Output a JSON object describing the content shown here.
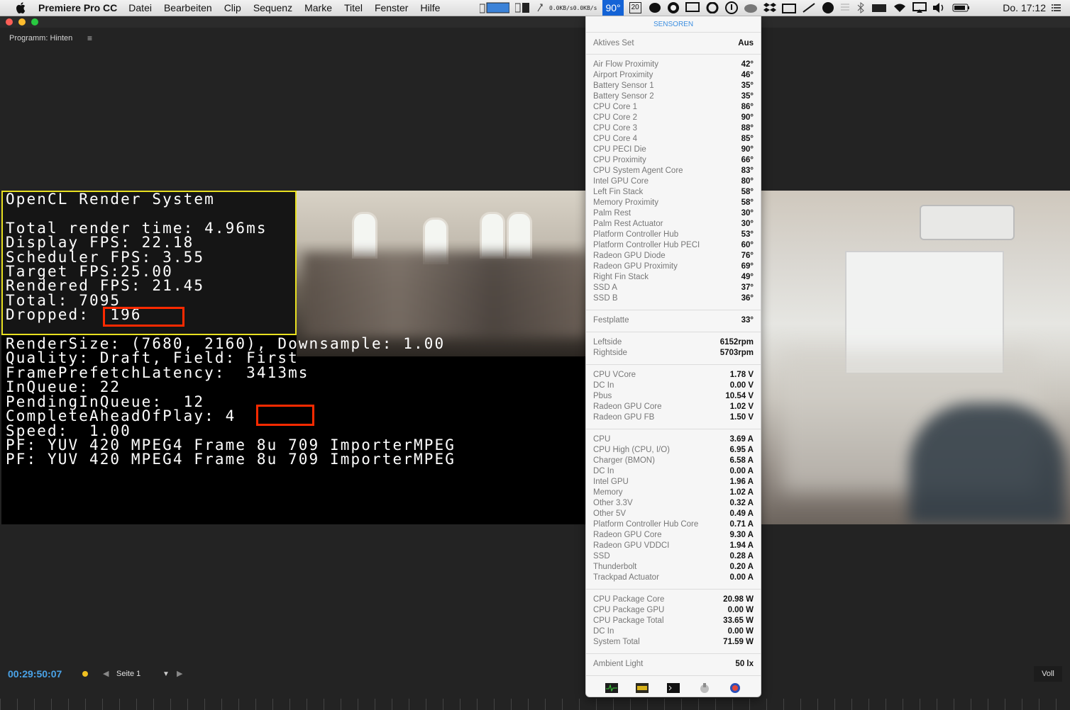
{
  "menubar": {
    "app_name": "Premiere Pro CC",
    "items": [
      "Datei",
      "Bearbeiten",
      "Clip",
      "Sequenz",
      "Marke",
      "Titel",
      "Fenster",
      "Hilfe"
    ],
    "net_up": "0.0KB/s",
    "net_down": "0.0KB/s",
    "temperature": "90°",
    "calendar": "20",
    "clock": "Do. 17:12"
  },
  "panel": {
    "title": "Programm: Hinten",
    "menu_glyph": "≡"
  },
  "diagnostics": {
    "lines": [
      "OpenCL Render System",
      "",
      "Total render time: 4.96ms",
      "Display FPS: 22.18",
      "Scheduler FPS: 3.55",
      "Target FPS:25.00",
      "Rendered FPS: 21.45",
      "Total: 7095",
      "Dropped:  196",
      "",
      "RenderSize: (7680, 2160), Downsample: 1.00",
      "Quality: Draft, Field: First",
      "FramePrefetchLatency:  3413ms",
      "InQueue: 22",
      "PendingInQueue:  12",
      "CompleteAheadOfPlay: 4",
      "Speed:  1.00",
      "PF: YUV 420 MPEG4 Frame 8u 709 ImporterMPEG",
      "PF: YUV 420 MPEG4 Frame 8u 709 ImporterMPEG"
    ]
  },
  "transport": {
    "timecode": "00:29:50:07",
    "page_label": "Seite 1",
    "zoom": "Voll",
    "marker_color": "#f0c020"
  },
  "sensors": {
    "title": "SENSOREN",
    "active_set": {
      "label": "Aktives Set",
      "value": "Aus"
    },
    "temperatures": [
      {
        "label": "Air Flow Proximity",
        "value": "42°"
      },
      {
        "label": "Airport Proximity",
        "value": "46°"
      },
      {
        "label": "Battery Sensor 1",
        "value": "35°"
      },
      {
        "label": "Battery Sensor 2",
        "value": "35°"
      },
      {
        "label": "CPU Core 1",
        "value": "86°"
      },
      {
        "label": "CPU Core 2",
        "value": "90°"
      },
      {
        "label": "CPU Core 3",
        "value": "88°"
      },
      {
        "label": "CPU Core 4",
        "value": "85°"
      },
      {
        "label": "CPU PECI Die",
        "value": "90°"
      },
      {
        "label": "CPU Proximity",
        "value": "66°"
      },
      {
        "label": "CPU System Agent Core",
        "value": "83°"
      },
      {
        "label": "Intel GPU Core",
        "value": "80°"
      },
      {
        "label": "Left Fin Stack",
        "value": "58°"
      },
      {
        "label": "Memory Proximity",
        "value": "58°"
      },
      {
        "label": "Palm Rest",
        "value": "30°"
      },
      {
        "label": "Palm Rest Actuator",
        "value": "30°"
      },
      {
        "label": "Platform Controller Hub",
        "value": "53°"
      },
      {
        "label": "Platform Controller Hub PECI",
        "value": "60°"
      },
      {
        "label": "Radeon GPU Diode",
        "value": "76°"
      },
      {
        "label": "Radeon GPU Proximity",
        "value": "69°"
      },
      {
        "label": "Right Fin Stack",
        "value": "49°"
      },
      {
        "label": "SSD A",
        "value": "37°"
      },
      {
        "label": "SSD B",
        "value": "36°"
      }
    ],
    "disk": [
      {
        "label": "Festplatte",
        "value": "33°"
      }
    ],
    "fans": [
      {
        "label": "Leftside",
        "value": "6152rpm"
      },
      {
        "label": "Rightside",
        "value": "5703rpm"
      }
    ],
    "voltages": [
      {
        "label": "CPU VCore",
        "value": "1.78 V"
      },
      {
        "label": "DC In",
        "value": "0.00 V"
      },
      {
        "label": "Pbus",
        "value": "10.54 V"
      },
      {
        "label": "Radeon GPU Core",
        "value": "1.02 V"
      },
      {
        "label": "Radeon GPU FB",
        "value": "1.50 V"
      }
    ],
    "currents": [
      {
        "label": "CPU",
        "value": "3.69 A"
      },
      {
        "label": "CPU High (CPU, I/O)",
        "value": "6.95 A"
      },
      {
        "label": "Charger (BMON)",
        "value": "6.58 A"
      },
      {
        "label": "DC In",
        "value": "0.00 A"
      },
      {
        "label": "Intel GPU",
        "value": "1.96 A"
      },
      {
        "label": "Memory",
        "value": "1.02 A"
      },
      {
        "label": "Other 3.3V",
        "value": "0.32 A"
      },
      {
        "label": "Other 5V",
        "value": "0.49 A"
      },
      {
        "label": "Platform Controller Hub Core",
        "value": "0.71 A"
      },
      {
        "label": "Radeon GPU Core",
        "value": "9.30 A"
      },
      {
        "label": "Radeon GPU VDDCI",
        "value": "1.94 A"
      },
      {
        "label": "SSD",
        "value": "0.28 A"
      },
      {
        "label": "Thunderbolt",
        "value": "0.20 A"
      },
      {
        "label": "Trackpad Actuator",
        "value": "0.00 A"
      }
    ],
    "power": [
      {
        "label": "CPU Package Core",
        "value": "20.98 W"
      },
      {
        "label": "CPU Package GPU",
        "value": "0.00 W"
      },
      {
        "label": "CPU Package Total",
        "value": "33.65 W"
      },
      {
        "label": "DC In",
        "value": "0.00 W"
      },
      {
        "label": "System Total",
        "value": "71.59 W"
      }
    ],
    "light": [
      {
        "label": "Ambient Light",
        "value": "50 lx"
      }
    ],
    "bottom_icons": [
      "activity-monitor-icon",
      "marker-app-icon",
      "terminal-icon",
      "disk-utility-icon",
      "istat-icon"
    ]
  }
}
